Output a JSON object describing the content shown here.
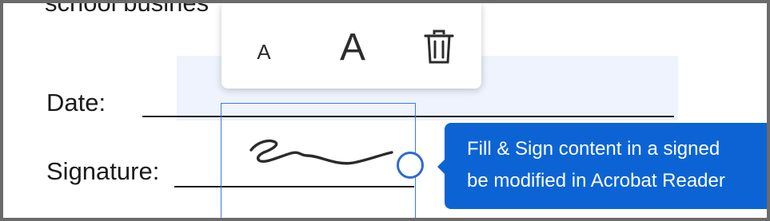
{
  "document": {
    "cut_text": "school busines",
    "date_label": "Date:",
    "signature_label": "Signature:"
  },
  "toolbar": {
    "decrease_size_label": "A",
    "increase_size_label": "A",
    "delete_icon": "trash-icon"
  },
  "tooltip": {
    "line1": "Fill & Sign content in a signed",
    "line2": "be modified in Acrobat Reader"
  },
  "colors": {
    "accent": "#0c64d4",
    "selection": "#3f7bd6",
    "field_band": "#eef3fd"
  }
}
